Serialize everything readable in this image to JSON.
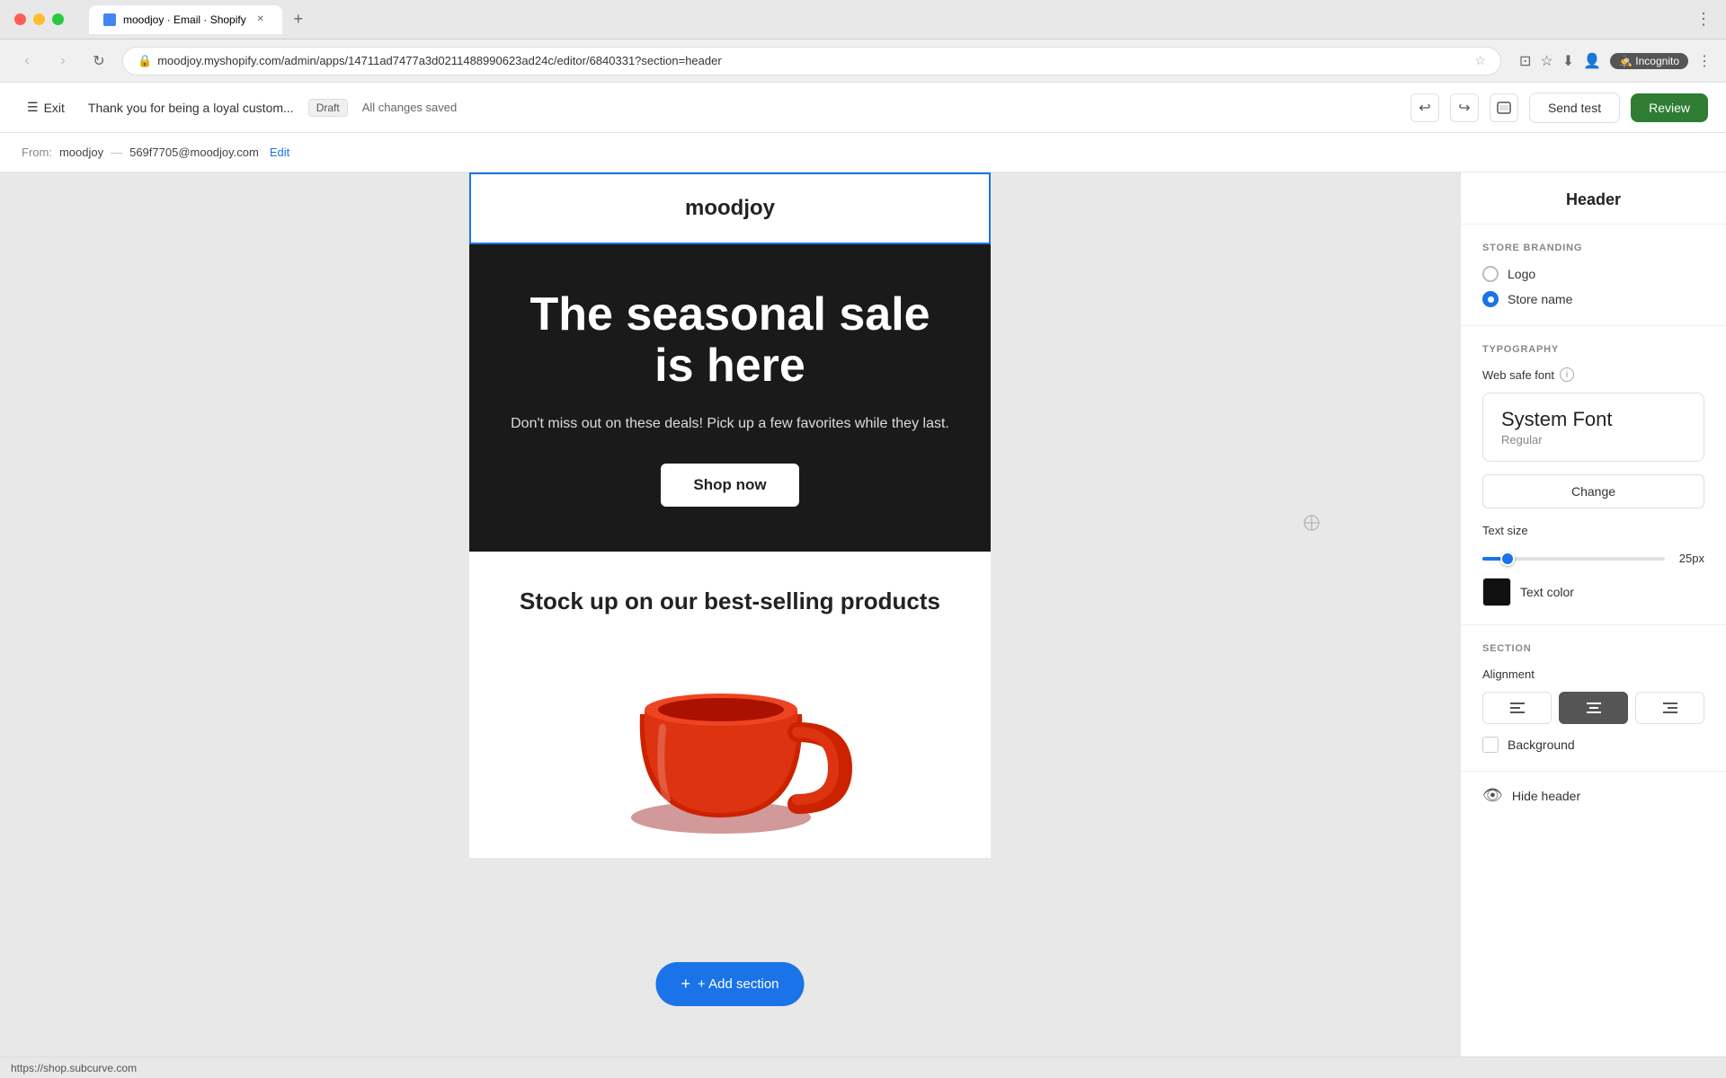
{
  "window": {
    "title": "moodjoy · Email · Shopify",
    "url": "moodjoy.myshopify.com/admin/apps/14711ad7477a3d0211488990623ad24c/editor/6840331?section=header"
  },
  "toolbar": {
    "exit_label": "Exit",
    "email_title": "Thank you for being a loyal custom...",
    "draft_label": "Draft",
    "saved_label": "All changes saved",
    "send_test_label": "Send test",
    "review_label": "Review",
    "undo_icon": "↩",
    "redo_icon": "↪",
    "preview_icon": "⊡"
  },
  "from_bar": {
    "label": "From:",
    "store_name": "moodjoy",
    "separator": "—",
    "email": "569f7705@moodjoy.com",
    "edit_label": "Edit"
  },
  "email_preview": {
    "header": {
      "store_name": "moodjoy"
    },
    "hero": {
      "title": "The seasonal sale is here",
      "description": "Don't miss out on these deals! Pick up a few favorites while they last.",
      "cta_label": "Shop now"
    },
    "products": {
      "title": "Stock up on our best-selling products"
    },
    "add_section_label": "+ Add section"
  },
  "right_panel": {
    "title": "Header",
    "store_branding": {
      "section_title": "STORE BRANDING",
      "logo_label": "Logo",
      "store_name_label": "Store name",
      "selected": "store_name"
    },
    "typography": {
      "section_title": "TYPOGRAPHY",
      "web_safe_font_label": "Web safe font",
      "font_name": "System Font",
      "font_style": "Regular",
      "change_label": "Change",
      "text_size_label": "Text size",
      "text_size_value": "25px",
      "slider_percent": 12,
      "text_color_label": "Text color",
      "text_color_hex": "#111111"
    },
    "section": {
      "section_title": "SECTION",
      "alignment_label": "Alignment",
      "align_left": "≡",
      "align_center": "≡",
      "align_right": "≡",
      "active_alignment": "center",
      "background_label": "Background"
    },
    "hide_header_label": "Hide header"
  },
  "status_bar": {
    "url": "https://shop.subcurve.com"
  }
}
